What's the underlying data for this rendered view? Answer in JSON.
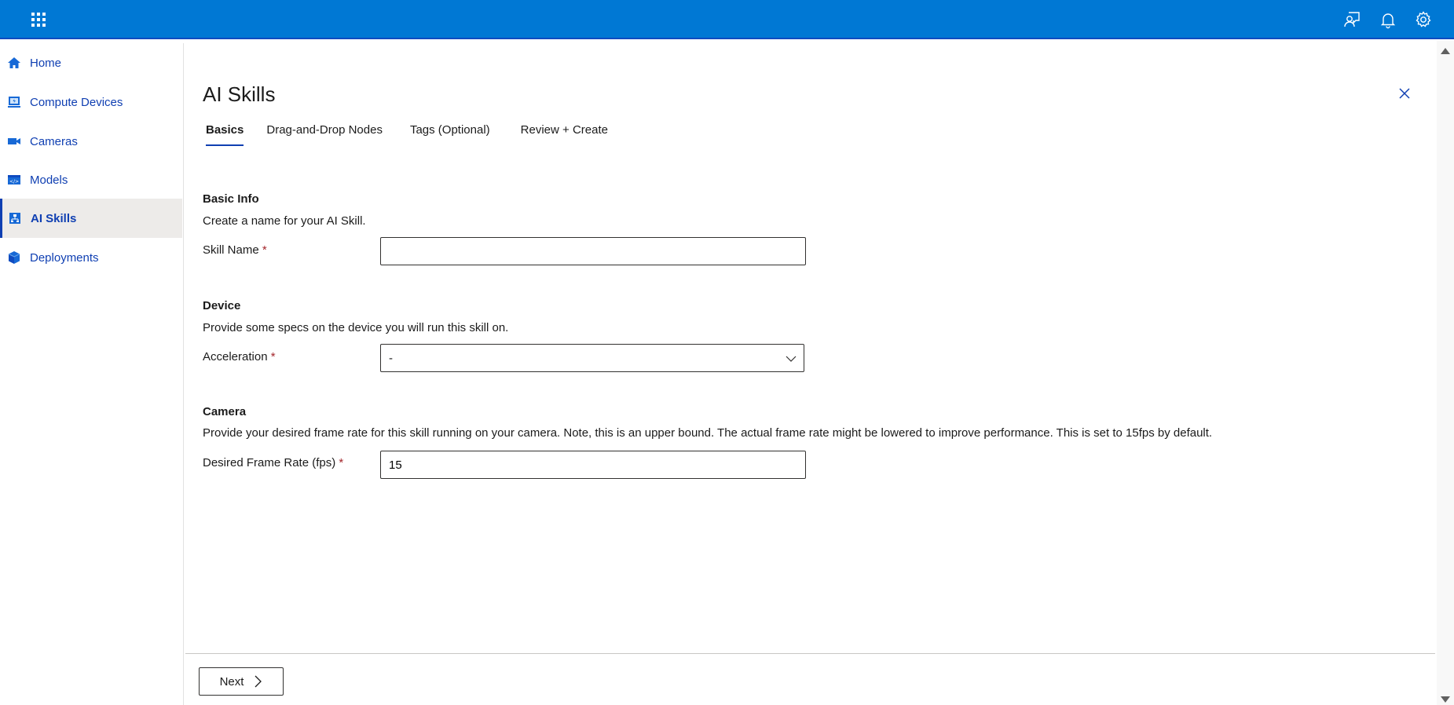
{
  "header": {
    "icons": [
      "app-launcher-icon",
      "feedback-icon",
      "notifications-icon",
      "settings-icon"
    ],
    "brand_color": "#0078d4"
  },
  "sidebar": {
    "items": [
      {
        "label": "Home",
        "icon": "home-icon",
        "active": false
      },
      {
        "label": "Compute Devices",
        "icon": "compute-device-icon",
        "active": false
      },
      {
        "label": "Cameras",
        "icon": "camera-icon",
        "active": false
      },
      {
        "label": "Models",
        "icon": "model-icon",
        "active": false
      },
      {
        "label": "AI Skills",
        "icon": "ai-skill-icon",
        "active": true
      },
      {
        "label": "Deployments",
        "icon": "deployment-icon",
        "active": false
      }
    ]
  },
  "main": {
    "title": "AI Skills",
    "tabs": [
      {
        "label": "Basics",
        "active": true
      },
      {
        "label": "Drag-and-Drop Nodes",
        "active": false
      },
      {
        "label": "Tags (Optional)",
        "active": false
      },
      {
        "label": "Review + Create",
        "active": false
      }
    ],
    "sections": {
      "basic_info": {
        "title": "Basic Info",
        "description": "Create a name for your AI Skill.",
        "skill_name_label": "Skill Name",
        "skill_name_value": "",
        "required_marker": "*"
      },
      "device": {
        "title": "Device",
        "description": "Provide some specs on the device you will run this skill on.",
        "acceleration_label": "Acceleration",
        "acceleration_value": "-",
        "required_marker": "*"
      },
      "camera": {
        "title": "Camera",
        "description": "Provide your desired frame rate for this skill running on your camera. Note, this is an upper bound. The actual frame rate might be lowered to improve performance. This is set to 15fps by default.",
        "frame_rate_label": "Desired Frame Rate (fps)",
        "frame_rate_value": "15",
        "required_marker": "*"
      }
    },
    "footer": {
      "next_label": "Next"
    }
  }
}
